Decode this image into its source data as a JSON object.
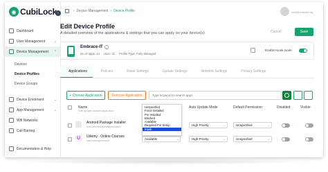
{
  "app": {
    "name": "CubiLock"
  },
  "breadcrumb": [
    "Device Management",
    "Device Profile"
  ],
  "user": {
    "email": "email@example.org"
  },
  "sidebar": {
    "items": [
      {
        "label": "Dashboard"
      },
      {
        "label": "User Management"
      },
      {
        "label": "Device Management"
      },
      {
        "label": "Device Enrolment"
      },
      {
        "label": "App Management"
      },
      {
        "label": "Wifi Networks"
      },
      {
        "label": "Call Barring"
      }
    ],
    "sub_items": [
      {
        "label": "Devices"
      },
      {
        "label": "Device Profiles"
      },
      {
        "label": "Device Groups"
      }
    ],
    "bottom": {
      "label": "Documentation & Help"
    }
  },
  "header": {
    "title": "Edit Device Profile",
    "subtitle": "A detailed overview of the applications & settings that you can apply on your device(s)",
    "cancel_label": "Cancel",
    "save_label": "Save"
  },
  "profile": {
    "name": "Embrace-IT",
    "apps_count": "No of apps: 14",
    "user_count": "User: 31",
    "profile_type": "Profile Type: Fully Managed",
    "kiosk_label": "Enable Kiosk mode",
    "kiosk_enabled": true
  },
  "tabs": [
    "Applications",
    "Policies",
    "Kiosk Settings",
    "Update Settings",
    "Network Settings",
    "Privacy Settings"
  ],
  "toolbar": {
    "choose_label": "+ Choose Application",
    "remove_label": "Remove Application",
    "search_placeholder": "Type keyword to search apps"
  },
  "table": {
    "headers": [
      "Name",
      "Auto Update Mode",
      "Default Permission",
      "Disabled",
      "Visible"
    ],
    "rows": [
      {
        "name": "",
        "package": "com.google.android.apps.docs"
      },
      {
        "name": "Android Package Installer",
        "package": "com.android.packageinstaller",
        "install_type": "",
        "update": "High Priority",
        "permission": "Unspecified",
        "disabled": false
      },
      {
        "name": "Udemy - Online Courses",
        "package": "com.udemy.android",
        "install_type": "Available",
        "update": "High Priority",
        "permission": "Unspecified",
        "disabled": false
      }
    ]
  },
  "install_type_options": [
    "Unspecified",
    "Force Installed",
    "Pre Installed",
    "Blocked",
    "Available",
    "Required For Setup",
    "Kiosk"
  ],
  "install_type_selected": "Kiosk",
  "colors": {
    "accent": "#15a36e",
    "warning": "#f97316",
    "selected": "#1d4ed8"
  }
}
